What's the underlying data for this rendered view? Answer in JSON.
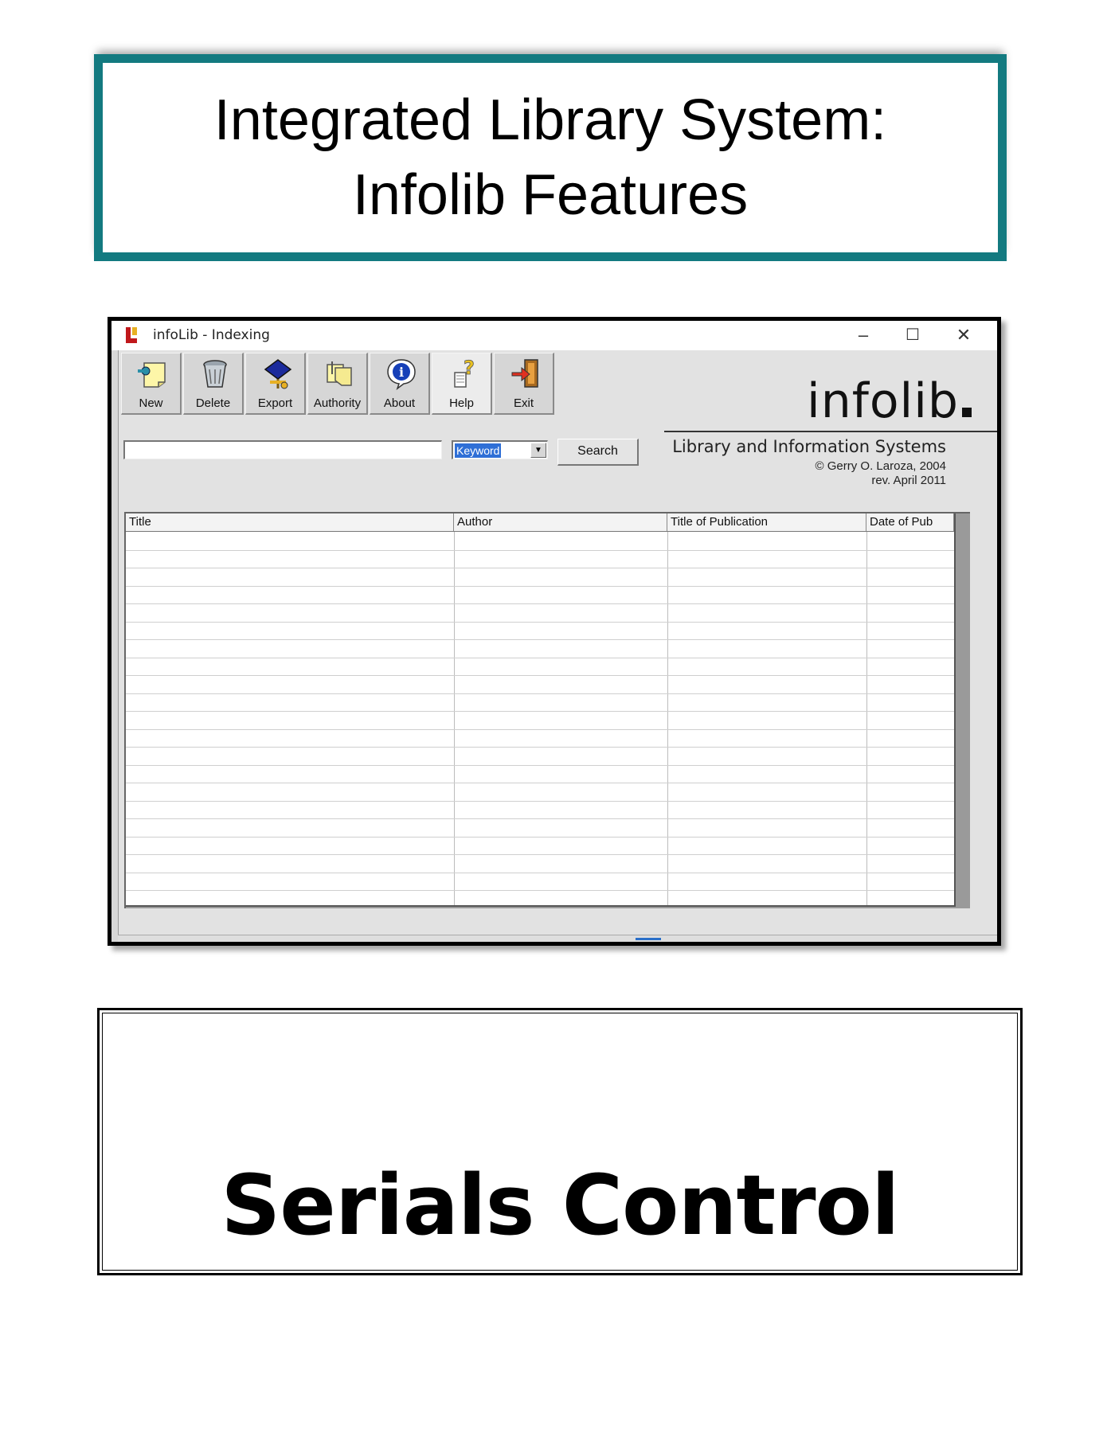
{
  "header": {
    "line1": "Integrated Library System:",
    "line2": "Infolib Features"
  },
  "window": {
    "title": "infoLib - Indexing",
    "controls": {
      "minimize": "–",
      "maximize": "☐",
      "close": "✕"
    }
  },
  "toolbar": {
    "buttons": [
      {
        "label": "New",
        "icon": "new-icon"
      },
      {
        "label": "Delete",
        "icon": "delete-icon"
      },
      {
        "label": "Export",
        "icon": "export-icon"
      },
      {
        "label": "Authority",
        "icon": "authority-icon"
      },
      {
        "label": "About",
        "icon": "about-icon"
      },
      {
        "label": "Help",
        "icon": "help-icon"
      },
      {
        "label": "Exit",
        "icon": "exit-icon"
      }
    ]
  },
  "brand": {
    "logo": "infolib",
    "subtitle": "Library and Information Systems",
    "copyright": "© Gerry O. Laroza, 2004",
    "revision": "rev. April 2011"
  },
  "search": {
    "query": "",
    "field_selected": "Keyword",
    "button_label": "Search"
  },
  "grid": {
    "columns": [
      "Title",
      "Author",
      "Title of Publication",
      "Date of Pub"
    ],
    "rows": []
  },
  "footer": {
    "label": "Serials Control"
  },
  "colors": {
    "title_border": "#137a80",
    "selection": "#2f6fd6"
  }
}
